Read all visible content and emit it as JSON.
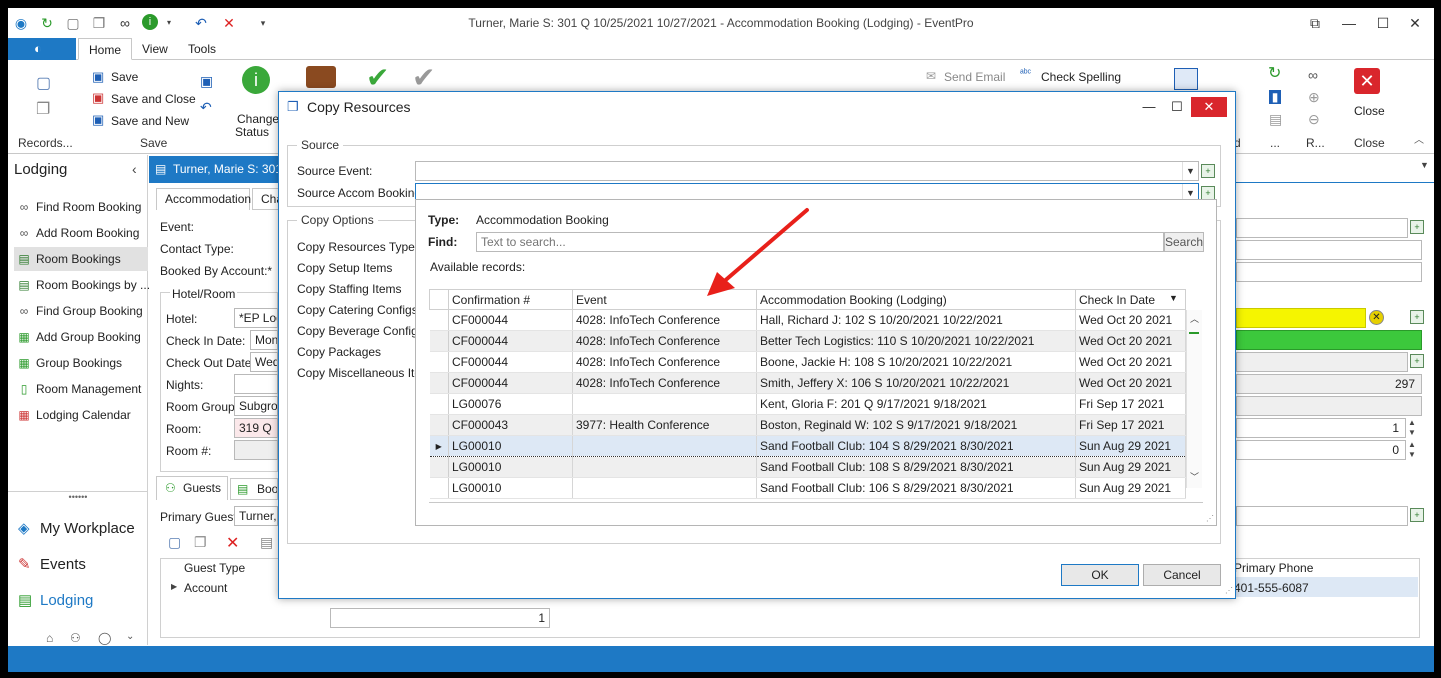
{
  "window": {
    "title": "Turner, Marie S: 301 Q 10/25/2021 10/27/2021  - Accommodation Booking (Lodging) - EventPro"
  },
  "ribbon": {
    "tabs": [
      "Home",
      "View",
      "Tools"
    ],
    "save": "Save",
    "save_close": "Save and Close",
    "save_new": "Save and New",
    "change_status": "Change",
    "change_status2": "Status",
    "send_email": "Send Email",
    "check_spelling": "Check Spelling",
    "close": "Close",
    "group_records": "Records...",
    "group_save": "Save",
    "group_d": "d",
    "group_dots": "...",
    "group_r": "R...",
    "group_close": "Close"
  },
  "sidenav": {
    "header": "Lodging",
    "items": [
      "Find Room Booking",
      "Add Room Booking",
      "Room Bookings",
      "Room Bookings by ...",
      "Find Group Booking",
      "Add Group Booking",
      "Group Bookings",
      "Room Management",
      "Lodging Calendar"
    ],
    "bottom": [
      "My Workplace",
      "Events",
      "Lodging"
    ]
  },
  "document": {
    "tab_label": "Turner, Marie S: 301",
    "subtabs": [
      "Accommodation",
      "Cha"
    ],
    "labels": {
      "event": "Event:",
      "contact_type": "Contact Type:",
      "booked_by": "Booked By Account:*",
      "hotel_room": "Hotel/Room",
      "hotel": "Hotel:",
      "check_in": "Check In Date:",
      "check_out": "Check Out Date:",
      "nights": "Nights:",
      "room_group": "Room Group:",
      "room": "Room:",
      "room_no": "Room #:",
      "primary_guest": "Primary Guest:"
    },
    "values": {
      "hotel": "*EP Lodg",
      "check_in": "Mon",
      "check_out": "Wed",
      "room_group": "Subgrou",
      "room": "319 Q",
      "primary_guest": "Turner,"
    },
    "guest_tabs": [
      "Guests",
      "Boo"
    ],
    "guest_cols": [
      "Guest Type",
      "Primary Phone"
    ],
    "guest_row": {
      "type": "Account",
      "phone": "401-555-6087"
    },
    "footer_count": "1",
    "right_values": {
      "num1": "297",
      "num2": "1",
      "num3": "0"
    }
  },
  "dialog": {
    "title": "Copy Resources",
    "source_group": "Source",
    "source_event_label": "Source Event:",
    "source_accom_label": "Source Accom Booking:",
    "copy_options_group": "Copy Options",
    "options": [
      "Copy Resources Type:",
      "Copy Setup Items",
      "Copy Staffing Items",
      "Copy Catering Configs",
      "Copy Beverage Configs",
      "Copy Packages",
      "Copy Miscellaneous Items"
    ],
    "ok": "OK",
    "cancel": "Cancel"
  },
  "popup": {
    "type_label": "Type:",
    "type_value": "Accommodation Booking",
    "find_label": "Find:",
    "find_placeholder": "Text to search...",
    "search_button": "Search",
    "available_label": "Available records:",
    "columns": [
      "Confirmation #",
      "Event",
      "Accommodation Booking (Lodging)",
      "Check In Date"
    ],
    "rows": [
      [
        "CF000044",
        "4028: InfoTech Conference",
        "Hall, Richard J: 102 S 10/20/2021 10/22/2021",
        "Wed Oct 20 2021"
      ],
      [
        "CF000044",
        "4028: InfoTech Conference",
        "Better Tech Logistics: 110 S 10/20/2021 10/22/2021",
        "Wed Oct 20 2021"
      ],
      [
        "CF000044",
        "4028: InfoTech Conference",
        "Boone, Jackie H: 108 S 10/20/2021 10/22/2021",
        "Wed Oct 20 2021"
      ],
      [
        "CF000044",
        "4028: InfoTech Conference",
        "Smith, Jeffery X: 106 S 10/20/2021 10/22/2021",
        "Wed Oct 20 2021"
      ],
      [
        "LG00076",
        "",
        "Kent, Gloria F: 201 Q 9/17/2021 9/18/2021",
        "Fri Sep 17 2021"
      ],
      [
        "CF000043",
        "3977: Health Conference",
        "Boston, Reginald W: 102 S 9/17/2021 9/18/2021",
        "Fri Sep 17 2021"
      ],
      [
        "LG00010",
        "",
        "Sand Football Club: 104 S 8/29/2021 8/30/2021",
        "Sun Aug 29 2021"
      ],
      [
        "LG00010",
        "",
        "Sand Football Club: 108 S 8/29/2021 8/30/2021",
        "Sun Aug 29 2021"
      ],
      [
        "LG00010",
        "",
        "Sand Football Club: 106 S 8/29/2021 8/30/2021",
        "Sun Aug 29 2021"
      ]
    ],
    "selected_row": 6
  },
  "colors": {
    "accent": "#1e79c5",
    "annotation_arrow": "#e8201a",
    "yellow_field": "#f5f500",
    "green_field": "#3cc83c"
  }
}
